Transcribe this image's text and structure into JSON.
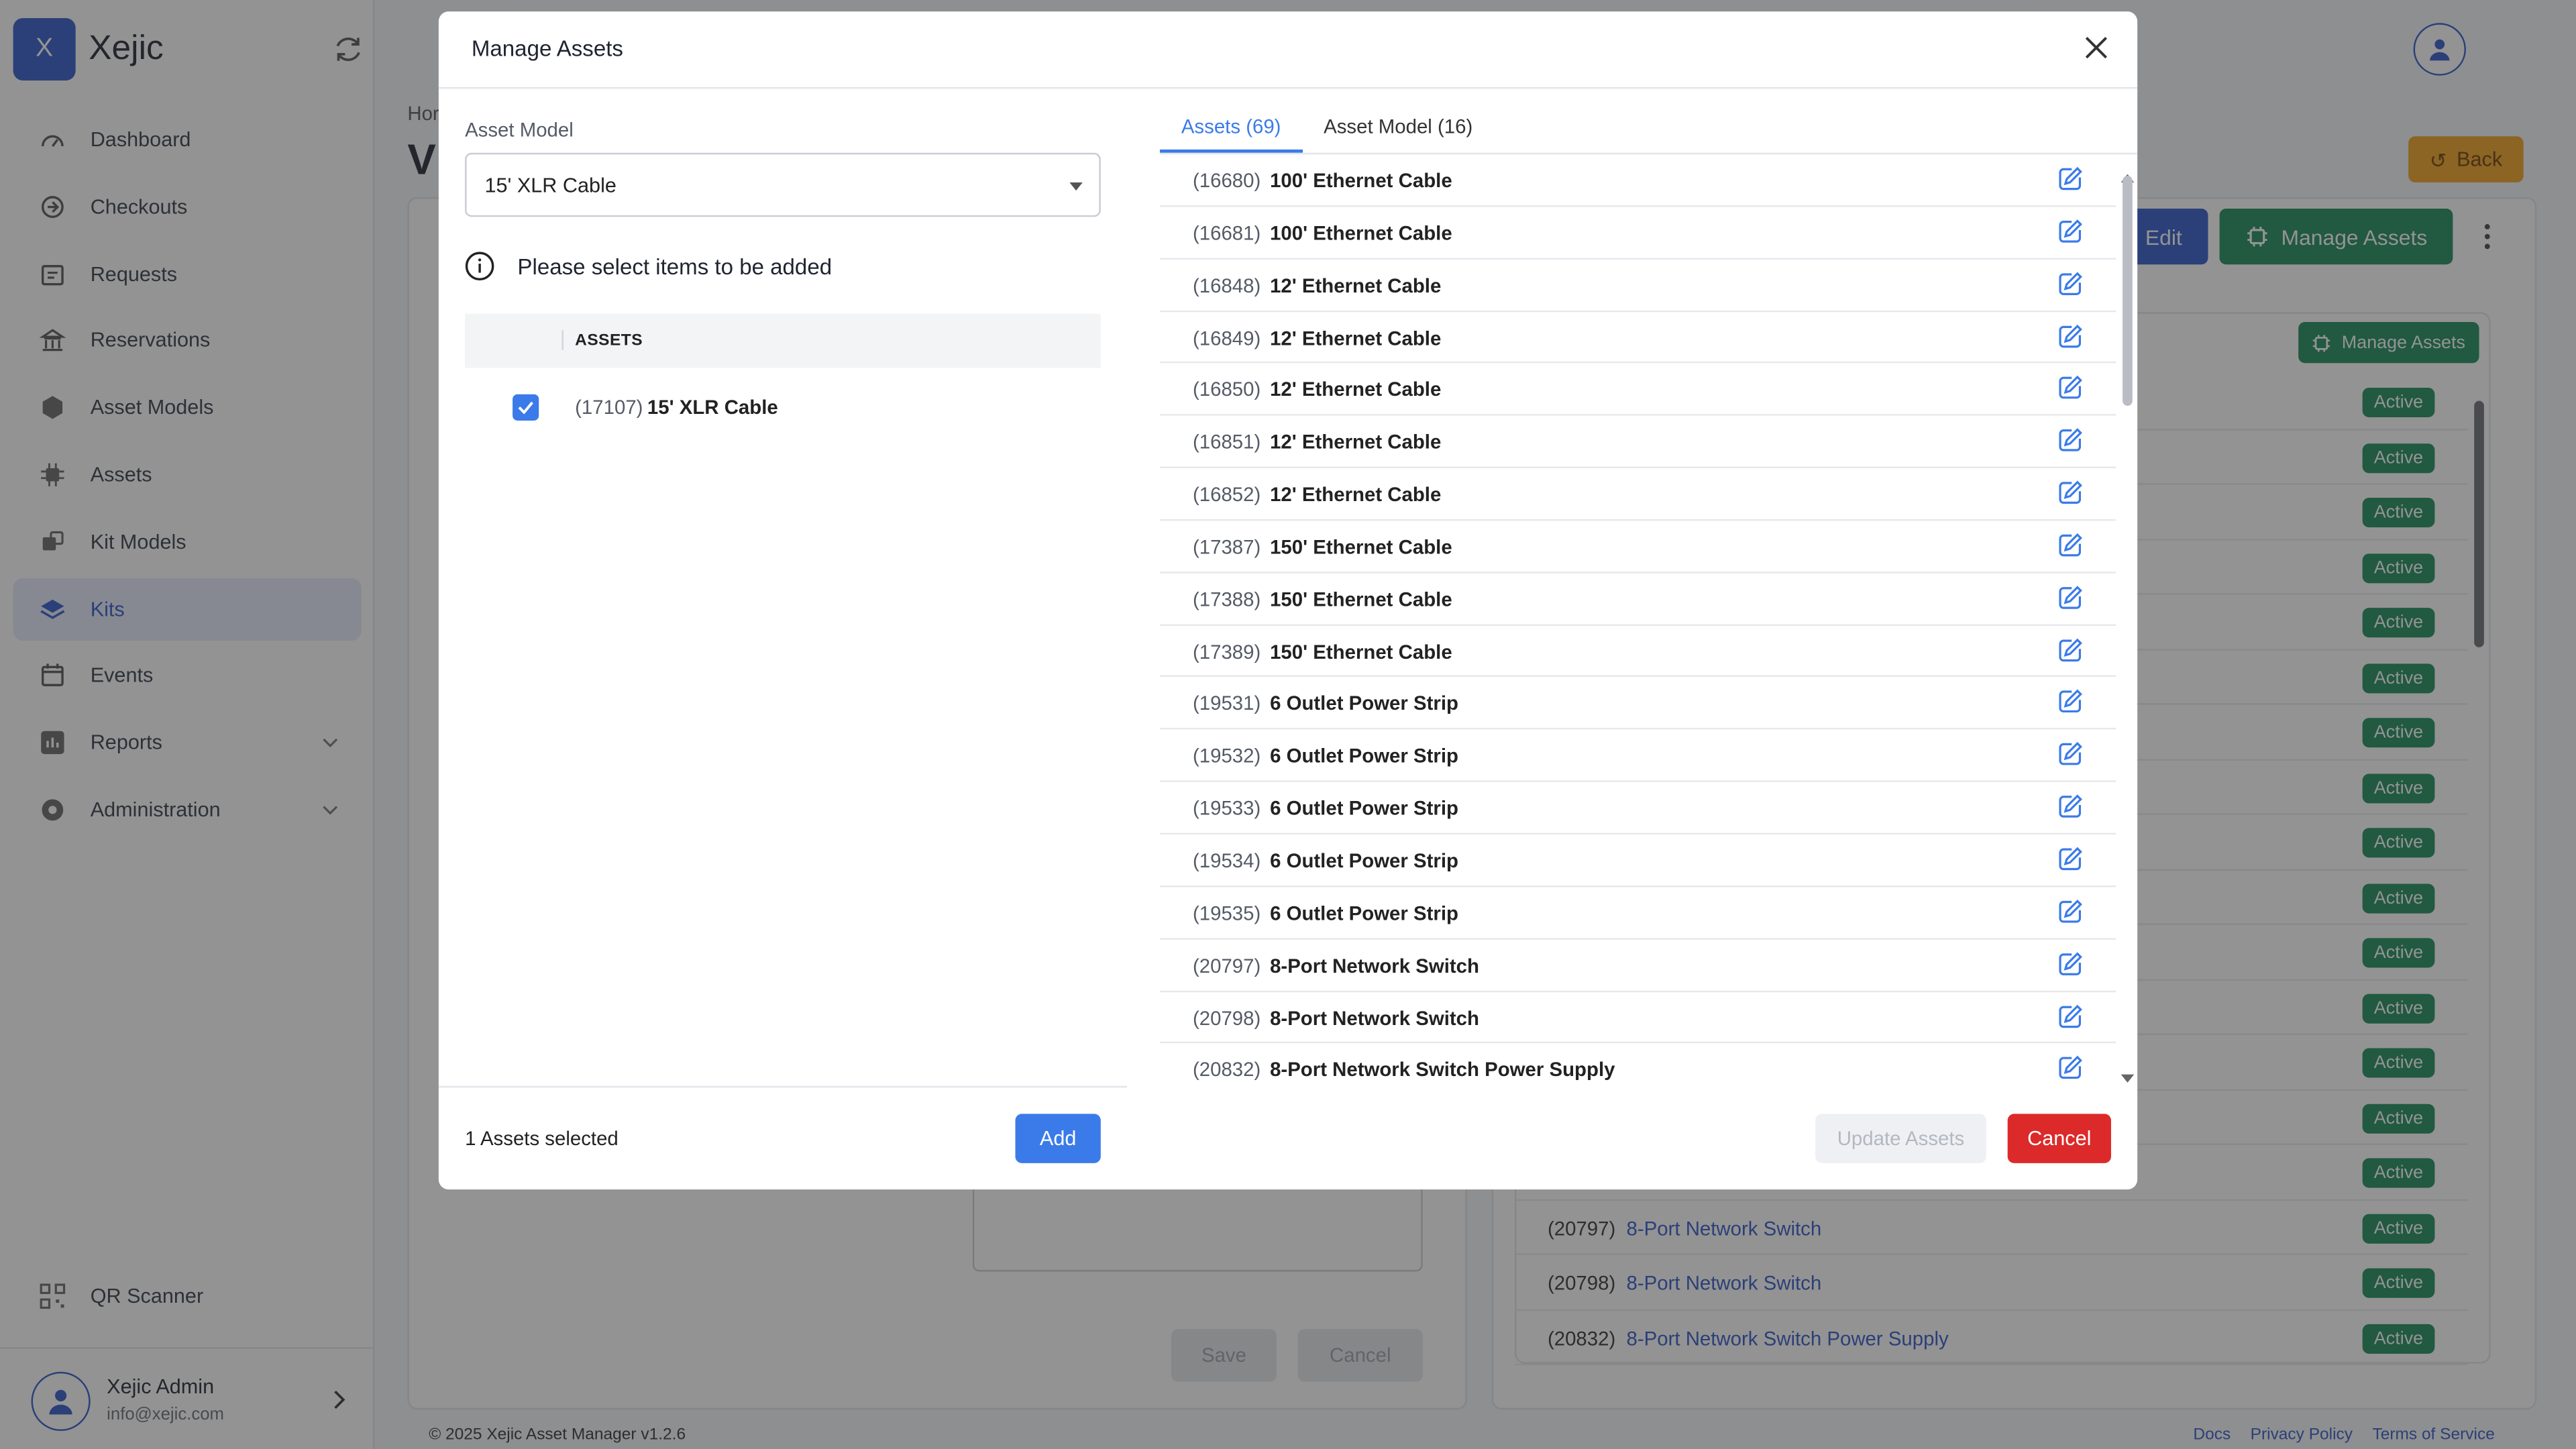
{
  "app": {
    "logo_letter": "X",
    "name": "Xejic"
  },
  "sidebar": {
    "items": [
      {
        "label": "Dashboard",
        "icon": "dashboard-icon"
      },
      {
        "label": "Checkouts",
        "icon": "checkouts-icon"
      },
      {
        "label": "Requests",
        "icon": "requests-icon"
      },
      {
        "label": "Reservations",
        "icon": "reservations-icon"
      },
      {
        "label": "Asset Models",
        "icon": "cube-icon"
      },
      {
        "label": "Assets",
        "icon": "chip-icon"
      },
      {
        "label": "Kit Models",
        "icon": "kit-models-icon"
      },
      {
        "label": "Kits",
        "icon": "layers-icon",
        "active": true
      },
      {
        "label": "Events",
        "icon": "calendar-icon"
      },
      {
        "label": "Reports",
        "icon": "chart-icon"
      },
      {
        "label": "Administration",
        "icon": "settings-icon"
      }
    ],
    "qr_label": "QR Scanner",
    "user": {
      "name": "Xejic Admin",
      "email": "info@xejic.com"
    }
  },
  "page": {
    "breadcrumb": "Hor",
    "title_letter": "V",
    "back_label": "Back",
    "edit_label": "Edit",
    "manage_assets_label": "Manage Assets",
    "manage_assets_small_label": "Manage Assets",
    "status_label": "Active",
    "visible_rows": [
      {
        "num": "(20797)",
        "name": "8-Port Network Switch"
      },
      {
        "num": "(20798)",
        "name": "8-Port Network Switch"
      },
      {
        "num": "(20832)",
        "name": "8-Port Network Switch Power Supply"
      }
    ],
    "save_label": "Save",
    "cancel_label": "Cancel"
  },
  "footer": {
    "copyright": "© 2025 Xejic Asset Manager v1.2.6",
    "docs": "Docs",
    "privacy": "Privacy Policy",
    "terms": "Terms of Service"
  },
  "modal": {
    "title": "Manage Assets",
    "asset_model_label": "Asset Model",
    "asset_model_value": "15' XLR Cable",
    "info_text": "Please select items to be added",
    "assets_column": "ASSETS",
    "selected_item": {
      "num": "(17107)",
      "name": "15' XLR Cable"
    },
    "selected_count": "1 Assets selected",
    "add_label": "Add",
    "tabs": [
      {
        "label": "Assets (69)",
        "active": true
      },
      {
        "label": "Asset Model (16)",
        "active": false
      }
    ],
    "assets": [
      {
        "num": "(16680)",
        "name": "100' Ethernet Cable"
      },
      {
        "num": "(16681)",
        "name": "100' Ethernet Cable"
      },
      {
        "num": "(16848)",
        "name": "12' Ethernet Cable"
      },
      {
        "num": "(16849)",
        "name": "12' Ethernet Cable"
      },
      {
        "num": "(16850)",
        "name": "12' Ethernet Cable"
      },
      {
        "num": "(16851)",
        "name": "12' Ethernet Cable"
      },
      {
        "num": "(16852)",
        "name": "12' Ethernet Cable"
      },
      {
        "num": "(17387)",
        "name": "150' Ethernet Cable"
      },
      {
        "num": "(17388)",
        "name": "150' Ethernet Cable"
      },
      {
        "num": "(17389)",
        "name": "150' Ethernet Cable"
      },
      {
        "num": "(19531)",
        "name": "6 Outlet Power Strip"
      },
      {
        "num": "(19532)",
        "name": "6 Outlet Power Strip"
      },
      {
        "num": "(19533)",
        "name": "6 Outlet Power Strip"
      },
      {
        "num": "(19534)",
        "name": "6 Outlet Power Strip"
      },
      {
        "num": "(19535)",
        "name": "6 Outlet Power Strip"
      },
      {
        "num": "(20797)",
        "name": "8-Port Network Switch"
      },
      {
        "num": "(20798)",
        "name": "8-Port Network Switch"
      },
      {
        "num": "(20832)",
        "name": "8-Port Network Switch Power Supply"
      }
    ],
    "update_label": "Update Assets",
    "cancel_label": "Cancel"
  },
  "colors": {
    "primary": "#2f56c9",
    "accent_blue": "#3b7be9",
    "success": "#1a8a5a",
    "danger": "#dc2a2a",
    "warning": "#f0a020"
  }
}
